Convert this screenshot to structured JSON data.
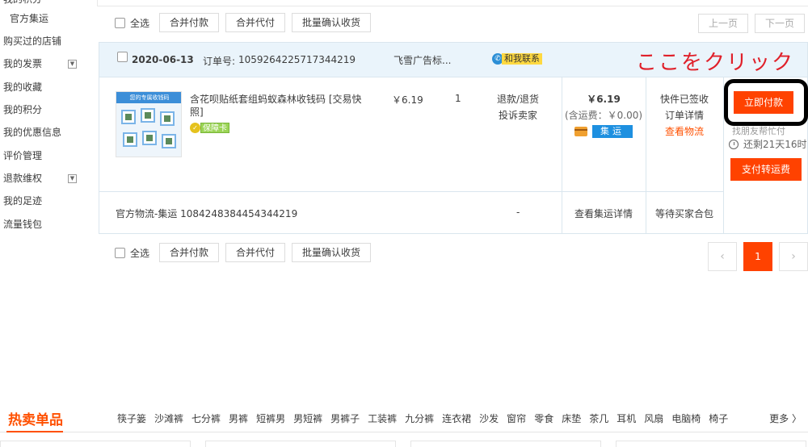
{
  "sidebar": {
    "items": [
      {
        "label": "我的积分_top",
        "text": "我的积分"
      },
      {
        "label": "官方集运"
      },
      {
        "label": "购买过的店铺"
      },
      {
        "label": "我的发票"
      },
      {
        "label": "我的收藏"
      },
      {
        "label": "我的积分"
      },
      {
        "label": "我的优惠信息"
      },
      {
        "label": "评价管理"
      },
      {
        "label": "退款维权"
      },
      {
        "label": "我的足迹"
      },
      {
        "label": "流量钱包"
      }
    ],
    "toggle_glyph": "▼"
  },
  "toolbar": {
    "select_all": "全选",
    "merge_pay": "合并付款",
    "merge_proxy_pay": "合并代付",
    "batch_confirm": "批量确认收货"
  },
  "pager_top": {
    "prev": "上一页",
    "next": "下一页"
  },
  "order": {
    "date": "2020-06-13",
    "order_no_label": "订单号:",
    "order_no": "1059264225717344219",
    "shop": "飞雪广告标...",
    "contact": "和我联系",
    "annotation": "ここをクリック",
    "product": {
      "thumb_text": "您的专属收钱码",
      "title": "含花呗贴纸套组蚂蚁森林收钱码 [交易快照]",
      "badge": "保障卡",
      "unit_price": "￥6.19",
      "quantity": "1",
      "after_sale_1": "退款/退货",
      "after_sale_2": "投诉卖家"
    },
    "total": {
      "price": "￥6.19",
      "shipping": "(含运费：￥0.00)",
      "tag": "集运"
    },
    "status": {
      "line1": "快件已签收",
      "line2": "订单详情",
      "line3": "查看物流"
    },
    "pay": {
      "pay_now": "立即付款",
      "hint": "找朋友帮忙付",
      "remaining": "还剩21天16时",
      "pay_shipping": "支付转运费"
    },
    "logistics": {
      "text": "官方物流-集运  10842483844543442​19",
      "dash": "-",
      "detail": "查看集运详情",
      "wait": "等待买家合包"
    }
  },
  "pager_bottom": {
    "prev": "‹",
    "current": "1",
    "next": "›"
  },
  "hot": {
    "title": "热卖单品",
    "tags": [
      "筷子篓",
      "沙滩裤",
      "七分裤",
      "男裤",
      "短裤男",
      "男短裤",
      "男裤子",
      "工装裤",
      "九分裤",
      "连衣裙",
      "沙发",
      "窗帘",
      "零食",
      "床垫",
      "茶几",
      "耳机",
      "风扇",
      "电脑椅",
      "椅子"
    ],
    "more": "更多 〉"
  },
  "colors": {
    "accent": "#ff4200",
    "link": "#ff5000",
    "header_bg": "#eaf4fb",
    "annotation": "#e0202a"
  }
}
